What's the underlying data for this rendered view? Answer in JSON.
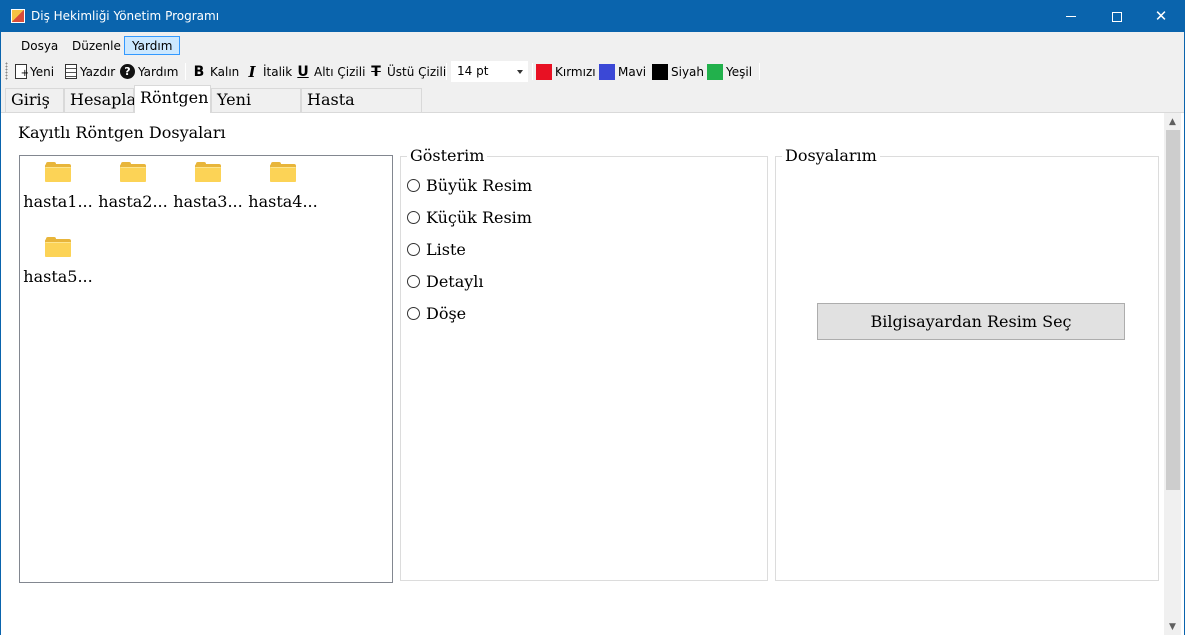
{
  "window": {
    "title": "Diş Hekimliği Yönetim Programı",
    "icons": {
      "minimize": "minimize-icon",
      "maximize": "maximize-icon",
      "close": "close-icon"
    }
  },
  "menu": {
    "items": [
      "Dosya",
      "Düzenle",
      "Yardım"
    ],
    "active": "Yardım"
  },
  "toolbar": {
    "new_label": "Yeni",
    "print_label": "Yazdır",
    "help_label": "Yardım",
    "bold_label": "Kalın",
    "italic_label": "İtalik",
    "underline_label": "Altı Çizili",
    "strike_label": "Üstü Çizili",
    "font_size": "14 pt",
    "colors": [
      {
        "label": "Kırmızı",
        "hex": "#e81123"
      },
      {
        "label": "Mavi",
        "hex": "#3b48d6"
      },
      {
        "label": "Siyah",
        "hex": "#000000"
      },
      {
        "label": "Yeşil",
        "hex": "#22b14c"
      }
    ]
  },
  "tabs": {
    "items": [
      "Giriş",
      "Hesapla",
      "Röntgen",
      "Yeni Hasta",
      "Hasta Kayıtları"
    ],
    "selected": "Röntgen"
  },
  "xray": {
    "title": "Kayıtlı Röntgen Dosyaları",
    "files": [
      "hasta1...",
      "hasta2...",
      "hasta3...",
      "hasta4...",
      "hasta5..."
    ]
  },
  "view_group": {
    "legend": "Gösterim",
    "options": [
      "Büyük Resim",
      "Küçük Resim",
      "Liste",
      "Detaylı",
      "Döşe"
    ]
  },
  "files_group": {
    "legend": "Dosyalarım",
    "button_label": "Bilgisayardan Resim Seç"
  }
}
